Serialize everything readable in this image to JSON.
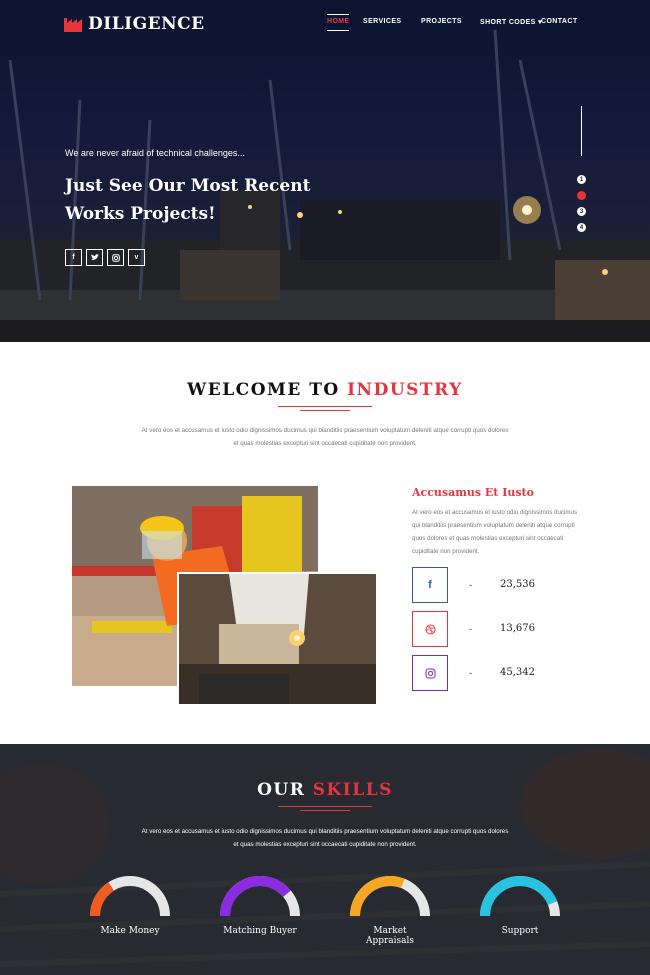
{
  "brand": {
    "name": "DILIGENCE",
    "accent": "#e8343d"
  },
  "nav": {
    "home": "HOME",
    "services": "SERVICES",
    "projects": "PROJECTS",
    "short_codes": "SHORT CODES",
    "contact": "CONTACT"
  },
  "hero": {
    "tagline": "We are never afraid of technical challenges...",
    "title": "Just See Our Most Recent Works Projects!",
    "socials": [
      "facebook-icon",
      "twitter-icon",
      "instagram-icon",
      "vimeo-icon"
    ],
    "slides": [
      "1",
      "2",
      "3",
      "4"
    ],
    "active_slide": 2
  },
  "welcome": {
    "title_a": "WELCOME TO ",
    "title_b": "INDUSTRY",
    "text": "At vero eos et accusamus et iusto odio dignissimos ducimus qui blanditiis praesentium voluptatum deleniti atque corrupti quos dolores et quas molestias excepturi sint occaecati cupiditate non provident.",
    "side_title": "Accusamus Et Iusto",
    "side_text": "At vero eos et accusamus et iusto odio dignissimos ducimus qui blanditiis praesentium voluptatum deleniti atque corrupti quos dolores et quas molestias excepturi sint occaecati cupiditate non provident.",
    "stats": [
      {
        "icon": "facebook-icon",
        "dash": "-",
        "value": "23,536",
        "color": "#3b5998"
      },
      {
        "icon": "dribbble-icon",
        "dash": "-",
        "value": "13,676",
        "color": "#e8343d"
      },
      {
        "icon": "instagram-icon",
        "dash": "-",
        "value": "45,342",
        "color": "#7b2aa8"
      }
    ]
  },
  "skills": {
    "title_a": "OUR ",
    "title_b": "SKILLS",
    "text": "At vero eos et accusamus et iusto odio dignissimos ducimus qui blanditiis praesentium voluptatum deleniti atque corrupti quos dolores et quas molestias excepturi sint occaecati cupiditate non provident.",
    "items": [
      {
        "label": "Make Money",
        "percent": 0.32,
        "color": "#f15a22"
      },
      {
        "label": "Matching Buyer",
        "percent": 0.78,
        "color": "#8b2be2"
      },
      {
        "label": "Market Appraisals",
        "percent": 0.62,
        "color": "#f5a623"
      },
      {
        "label": "Support",
        "percent": 0.88,
        "color": "#29c2e0"
      }
    ]
  }
}
